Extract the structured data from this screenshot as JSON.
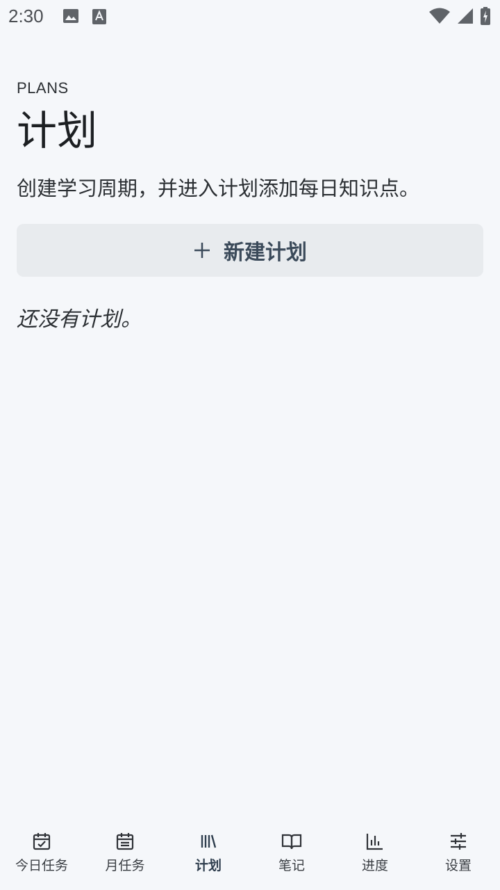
{
  "status_bar": {
    "time": "2:30",
    "left_icons": [
      "image-icon",
      "font-download-icon"
    ],
    "right_icons": [
      "wifi-icon",
      "signal-icon",
      "battery-icon"
    ]
  },
  "header": {
    "eyebrow": "PLANS",
    "title": "计划",
    "subtitle": "创建学习周期，并进入计划添加每日知识点。"
  },
  "new_plan_button": {
    "icon": "plus-icon",
    "label": "新建计划"
  },
  "empty_state": "还没有计划。",
  "bottom_nav": {
    "active_index": 2,
    "items": [
      {
        "label": "今日任务",
        "icon": "calendar-check-icon"
      },
      {
        "label": "月任务",
        "icon": "calendar-list-icon"
      },
      {
        "label": "计划",
        "icon": "library-icon"
      },
      {
        "label": "笔记",
        "icon": "book-open-icon"
      },
      {
        "label": "进度",
        "icon": "bar-chart-icon"
      },
      {
        "label": "设置",
        "icon": "sliders-icon"
      }
    ]
  },
  "colors": {
    "background": "#f5f7fa",
    "button_bg": "#e8ebee",
    "button_text": "#3b4a5a",
    "active_nav": "#2f3e4e"
  }
}
